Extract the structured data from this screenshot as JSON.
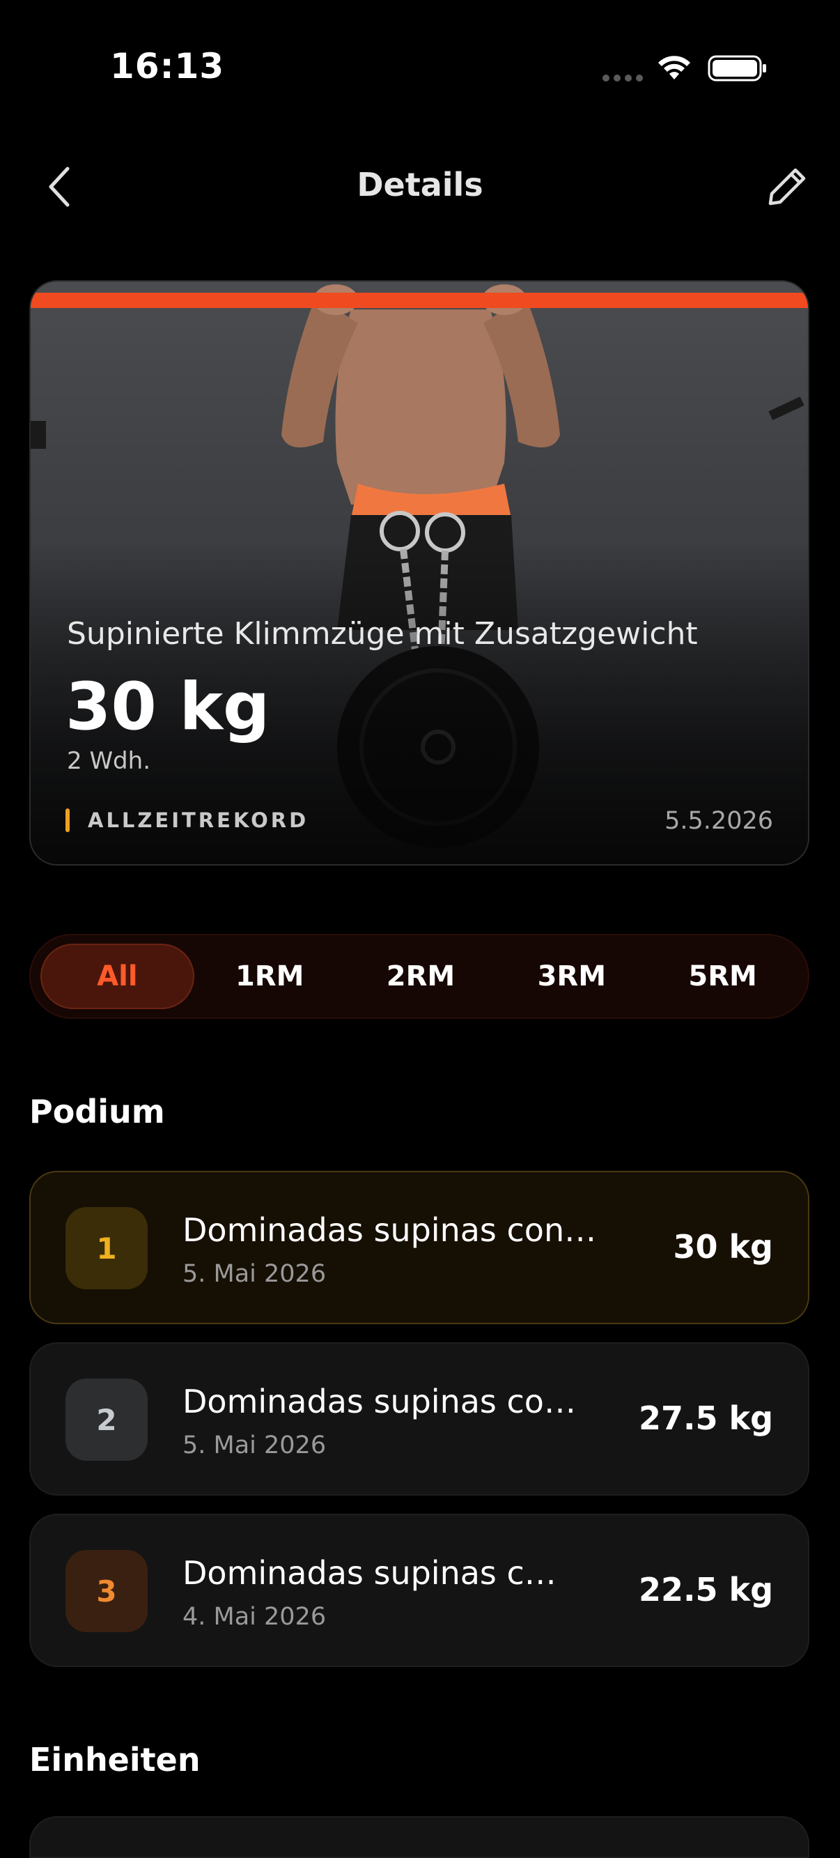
{
  "status_bar": {
    "time": "16:13"
  },
  "nav": {
    "title": "Details",
    "back_icon": "chevron-left-icon",
    "edit_icon": "pencil-icon"
  },
  "hero": {
    "exercise_name": "Supinierte Klimmzüge mit Zusatzgewicht",
    "weight": "30 kg",
    "reps": "2 Wdh.",
    "record_label": "ALLZEITREKORD",
    "date": "5.5.2026",
    "accent_color": "#f0a020"
  },
  "filters": {
    "selected": "All",
    "tabs": [
      "All",
      "1RM",
      "2RM",
      "3RM",
      "5RM"
    ],
    "active_color": "#ff5a2a"
  },
  "podium": {
    "title": "Podium",
    "items": [
      {
        "rank": "1",
        "title": "Dominadas supinas con lastre",
        "date": "5. Mai 2026",
        "weight": "30 kg"
      },
      {
        "rank": "2",
        "title": "Dominadas supinas con lastre",
        "date": "5. Mai 2026",
        "weight": "27.5 kg"
      },
      {
        "rank": "3",
        "title": "Dominadas supinas con lastre",
        "date": "4. Mai 2026",
        "weight": "22.5 kg"
      }
    ]
  },
  "units": {
    "title": "Einheiten"
  }
}
